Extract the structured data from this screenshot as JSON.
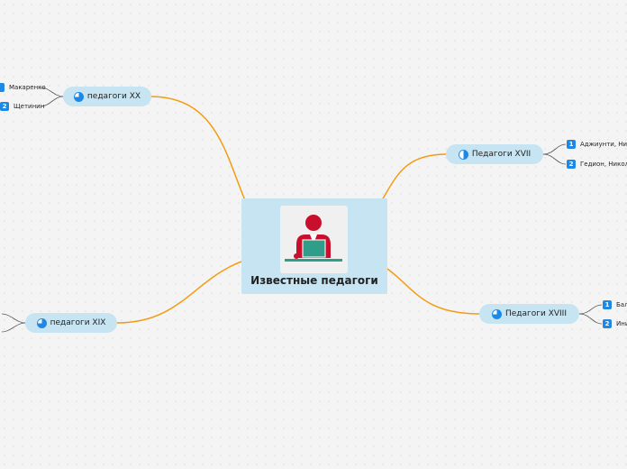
{
  "central": {
    "title": "Известные педагоги",
    "icon": "teacher-at-laptop-icon"
  },
  "colors": {
    "link": "#f39c12",
    "node_bg": "#c6e4f2",
    "badge": "#1e88e5",
    "pie_fill": "#1e88e5"
  },
  "branches": {
    "xx": {
      "label": "педагоги XX",
      "leaves": [
        {
          "num": "",
          "text": "Макаренко"
        },
        {
          "num": "2",
          "text": "Щетинин"
        }
      ]
    },
    "xix": {
      "label": "педагоги XIX",
      "leaves": []
    },
    "xvii": {
      "label": "Педагоги XVII",
      "leaves": [
        {
          "num": "1",
          "text": "Аджиунти, Ник"
        },
        {
          "num": "2",
          "text": "Гедион, Никола"
        }
      ]
    },
    "xviii": {
      "label": "Педагоги XVIII",
      "leaves": [
        {
          "num": "1",
          "text": "Бал"
        },
        {
          "num": "2",
          "text": "Ини"
        }
      ]
    }
  }
}
